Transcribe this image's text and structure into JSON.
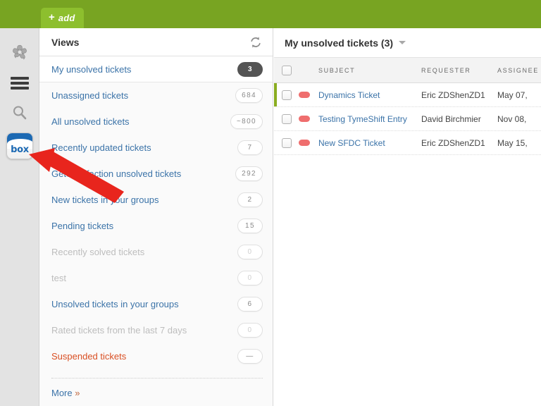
{
  "topbar": {
    "add_button": {
      "label": "add",
      "plus": "+",
      "icon": "plus-icon"
    },
    "color": "#78a422",
    "tab_color": "#8dbf2e"
  },
  "rail": {
    "items": [
      {
        "name": "settings-pinwheel-icon",
        "label": ""
      },
      {
        "name": "menu-hamburger-icon",
        "label": ""
      },
      {
        "name": "search-icon",
        "label": ""
      },
      {
        "name": "box-app-icon",
        "label": "box"
      }
    ]
  },
  "views": {
    "header": {
      "title": "Views",
      "refresh_icon": "refresh-icon"
    },
    "items": [
      {
        "label": "My unsolved tickets",
        "count": "3",
        "state": "selected"
      },
      {
        "label": "Unassigned tickets",
        "count": "684",
        "state": "normal"
      },
      {
        "label": "All unsolved tickets",
        "count": "~800",
        "state": "normal"
      },
      {
        "label": "Recently updated tickets",
        "count": "7",
        "state": "normal"
      },
      {
        "label": "GetSatisfaction unsolved tickets",
        "count": "292",
        "state": "normal"
      },
      {
        "label": "New tickets in your groups",
        "count": "2",
        "state": "normal"
      },
      {
        "label": "Pending tickets",
        "count": "15",
        "state": "normal"
      },
      {
        "label": "Recently solved tickets",
        "count": "0",
        "state": "disabled"
      },
      {
        "label": "test",
        "count": "0",
        "state": "disabled"
      },
      {
        "label": "Unsolved tickets in your groups",
        "count": "6",
        "state": "normal"
      },
      {
        "label": "Rated tickets from the last 7 days",
        "count": "0",
        "state": "disabled"
      },
      {
        "label": "Suspended tickets",
        "count": "—",
        "state": "alert"
      }
    ],
    "more_label": "More",
    "more_chevron": "»"
  },
  "main": {
    "title": "My unsolved tickets (3)",
    "caret_icon": "chevron-down-icon",
    "columns": [
      {
        "key": "subject",
        "label": "Subject"
      },
      {
        "key": "requester",
        "label": "Requester"
      },
      {
        "key": "assignee",
        "label": "Assignee"
      }
    ],
    "rows": [
      {
        "subject": "Dynamics Ticket",
        "requester": "Eric ZDShenZD1",
        "assignee": "May 07,",
        "flag": true,
        "priority": "red"
      },
      {
        "subject": "Testing TymeShift Entry",
        "requester": "David Birchmier",
        "assignee": "Nov 08,",
        "flag": false,
        "priority": "red"
      },
      {
        "subject": "New SFDC Ticket",
        "requester": "Eric ZDShenZD1",
        "assignee": "May 15,",
        "flag": false,
        "priority": "red"
      }
    ]
  },
  "annotation": {
    "type": "red-arrow",
    "color": "#e8251d",
    "points_to": "box-app-icon"
  }
}
